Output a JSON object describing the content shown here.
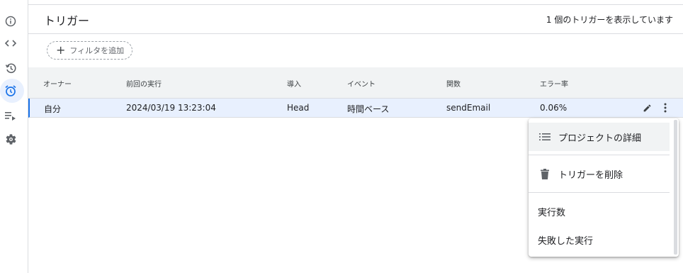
{
  "header": {
    "title": "トリガー",
    "summary": "1 個のトリガーを表示しています"
  },
  "filter": {
    "label": "フィルタを追加"
  },
  "table": {
    "columns": [
      "オーナー",
      "前回の実行",
      "導入",
      "イベント",
      "関数",
      "エラー率"
    ],
    "rows": [
      [
        "自分",
        "2024/03/19 13:23:04",
        "Head",
        "時間ベース",
        "sendEmail",
        "0.06%"
      ]
    ]
  },
  "menu": {
    "items": [
      {
        "label": "プロジェクトの詳細",
        "icon": "list-icon"
      },
      {
        "label": "トリガーを削除",
        "icon": "trash-icon"
      },
      {
        "label": "実行数"
      },
      {
        "label": "失敗した実行"
      }
    ]
  },
  "rail": {
    "items": [
      "info-icon",
      "code-icon",
      "history-icon",
      "alarm-icon",
      "executions-icon",
      "settings-icon"
    ],
    "active": "alarm-icon"
  },
  "colors": {
    "accent": "#1a73e8",
    "selected_row": "#e8f0fe"
  }
}
